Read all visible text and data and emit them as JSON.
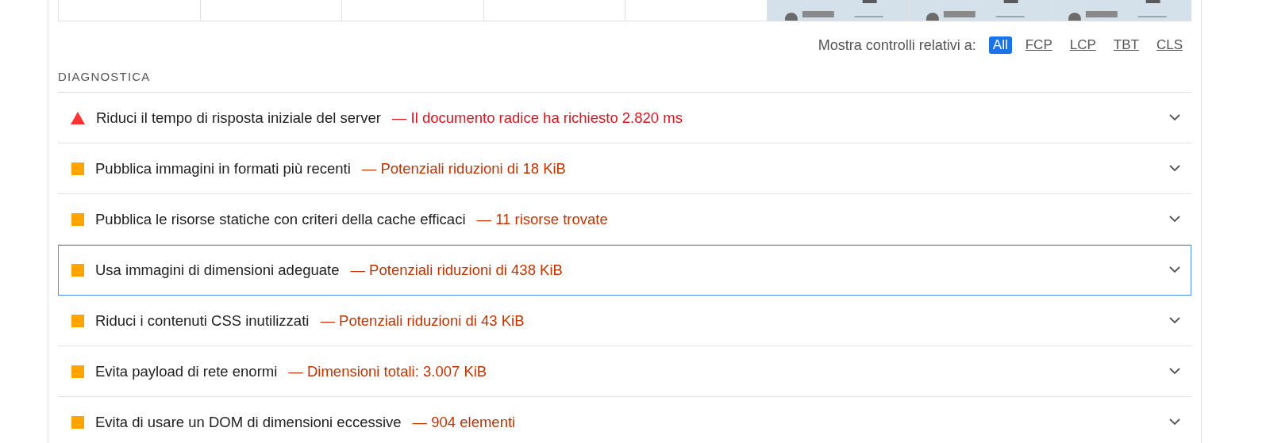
{
  "filmstrip": [
    {
      "kind": "blank"
    },
    {
      "kind": "blank"
    },
    {
      "kind": "blank"
    },
    {
      "kind": "blank"
    },
    {
      "kind": "blank"
    },
    {
      "kind": "picture"
    },
    {
      "kind": "picture"
    },
    {
      "kind": "picture"
    }
  ],
  "filter": {
    "label": "Mostra controlli relativi a:",
    "options": [
      {
        "label": "All",
        "selected": true
      },
      {
        "label": "FCP",
        "selected": false
      },
      {
        "label": "LCP",
        "selected": false
      },
      {
        "label": "TBT",
        "selected": false
      },
      {
        "label": "CLS",
        "selected": false
      }
    ]
  },
  "section_title": "DIAGNOSTICA",
  "audits": [
    {
      "kind": "fail",
      "title": "Riduci il tempo di risposta iniziale del server",
      "detail": "— Il documento radice ha richiesto 2.820 ms",
      "focused": false
    },
    {
      "kind": "average",
      "title": "Pubblica immagini in formati più recenti",
      "detail": "— Potenziali riduzioni di 18 KiB",
      "focused": false
    },
    {
      "kind": "average",
      "title": "Pubblica le risorse statiche con criteri della cache efficaci",
      "detail": "— 11 risorse trovate",
      "focused": false
    },
    {
      "kind": "average",
      "title": "Usa immagini di dimensioni adeguate",
      "detail": "— Potenziali riduzioni di 438 KiB",
      "focused": true
    },
    {
      "kind": "average",
      "title": "Riduci i contenuti CSS inutilizzati",
      "detail": "— Potenziali riduzioni di 43 KiB",
      "focused": false
    },
    {
      "kind": "average",
      "title": "Evita payload di rete enormi",
      "detail": "— Dimensioni totali: 3.007 KiB",
      "focused": false
    },
    {
      "kind": "average",
      "title": "Evita di usare un DOM di dimensioni eccessive",
      "detail": "— 904 elementi",
      "focused": false
    }
  ]
}
